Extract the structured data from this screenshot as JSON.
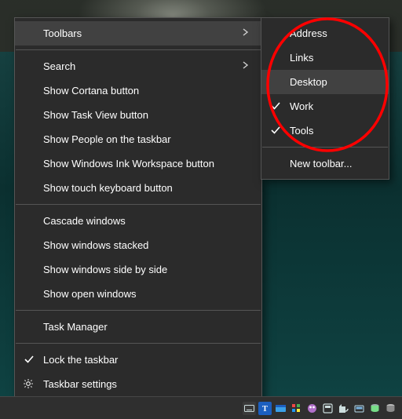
{
  "main_menu": {
    "toolbars": "Toolbars",
    "search": "Search",
    "cortana": "Show Cortana button",
    "taskview": "Show Task View button",
    "people": "Show People on the taskbar",
    "ink": "Show Windows Ink Workspace button",
    "touchkb": "Show touch keyboard button",
    "cascade": "Cascade windows",
    "stacked": "Show windows stacked",
    "sidebyside": "Show windows side by side",
    "openwin": "Show open windows",
    "taskmgr": "Task Manager",
    "locktb": "Lock the taskbar",
    "tbsettings": "Taskbar settings"
  },
  "sub_menu": {
    "address": "Address",
    "links": "Links",
    "desktop": "Desktop",
    "work": "Work",
    "tools": "Tools",
    "newtb": "New toolbar..."
  },
  "submenu_checked": {
    "work": true,
    "tools": true
  },
  "submenu_hover": "desktop",
  "mainmenu_hover": "toolbars",
  "mainmenu_checked": {
    "locktb": true
  },
  "annotation": {
    "shape": "ellipse",
    "color": "#ff0000"
  },
  "tray_icons": [
    "keyboard-icon",
    "language-icon",
    "t-app-icon",
    "app-blue-icon",
    "squares-icon",
    "palette-icon",
    "calendar-icon",
    "speaker-icon",
    "terminal-icon",
    "disk-icon"
  ]
}
